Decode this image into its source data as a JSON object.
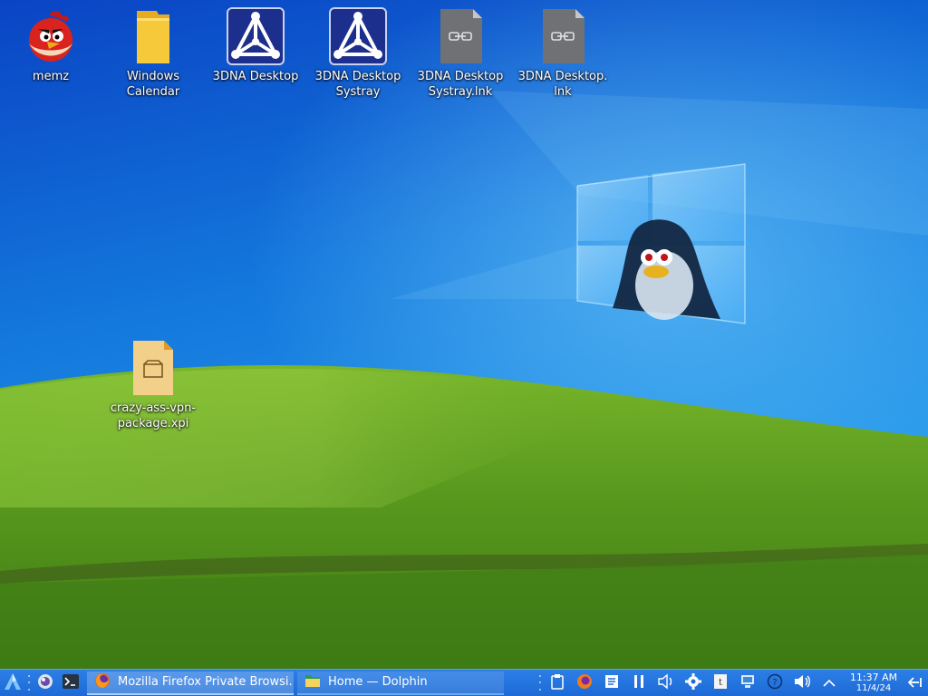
{
  "desktop": {
    "icons": [
      {
        "label": "memz",
        "icon": "angry-bird-icon"
      },
      {
        "label": "Windows\nCalendar",
        "icon": "folder-icon"
      },
      {
        "label": "3DNA Desktop",
        "icon": "3dna-app-icon"
      },
      {
        "label": "3DNA Desktop\nSystray",
        "icon": "3dna-app-icon"
      },
      {
        "label": "3DNA Desktop\nSystray.lnk",
        "icon": "shortcut-file-icon"
      },
      {
        "label": "3DNA Desktop.\nlnk",
        "icon": "shortcut-file-icon"
      },
      {
        "label": "crazy-ass-vpn-\npackage.xpi",
        "icon": "package-file-icon"
      }
    ],
    "wallpaper": "bliss-hill-with-windows-logo-and-penguin"
  },
  "taskbar": {
    "launchers": [
      {
        "name": "app-launcher",
        "icon": "kde-launcher-icon"
      },
      {
        "name": "firefox-launcher",
        "icon": "browser-icon"
      },
      {
        "name": "terminal-launcher",
        "icon": "terminal-icon"
      }
    ],
    "tasks": [
      {
        "label": "Mozilla Firefox Private Browsi...",
        "icon": "firefox-icon",
        "state": "active"
      },
      {
        "label": "Home — Dolphin",
        "icon": "dolphin-folder-icon",
        "state": "normal"
      }
    ],
    "tray": [
      "clipboard-icon",
      "firefox-tray-icon",
      "notes-icon",
      "pause-icon",
      "volume-outline-icon",
      "settings-gear-icon",
      "text-icon",
      "network-icon",
      "help-icon",
      "volume-icon",
      "show-hidden-icon"
    ],
    "clock": {
      "time": "11:37 AM",
      "date": "11/4/24"
    },
    "show_desktop_icon": "peek-desktop-icon"
  },
  "colors": {
    "taskbar": "#1d6ad6",
    "sky_top": "#0b4fc8",
    "sky_bottom": "#1b93e8",
    "grass": "#4f8f1c"
  }
}
